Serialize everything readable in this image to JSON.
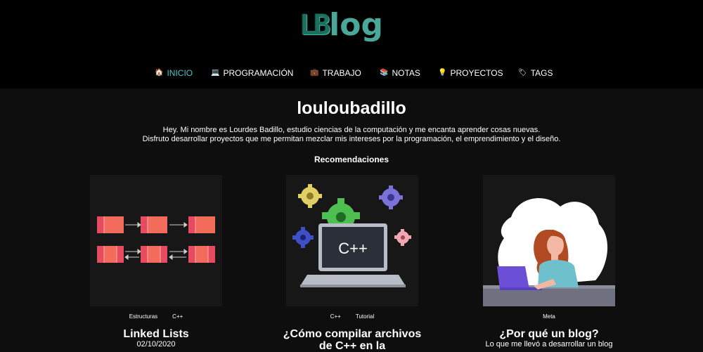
{
  "logo": {
    "brand": "LB",
    "suffix": "log"
  },
  "nav": [
    {
      "icon": "🏠",
      "label": "INICIO"
    },
    {
      "icon": "💻",
      "label": "PROGRAMACIÓN"
    },
    {
      "icon": "💼",
      "label": "TRABAJO"
    },
    {
      "icon": "📚",
      "label": "NOTAS"
    },
    {
      "icon": "💡",
      "label": "PROYECTOS"
    },
    {
      "icon": "🏷",
      "label": "TAGS"
    }
  ],
  "profile": {
    "name": "louloubadillo",
    "bio_line1": "Hey. Mi nombre es Lourdes Badillo, estudio ciencias de la computación y me encanta aprender cosas nuevas.",
    "bio_line2": "Disfruto desarrollar proyectos que me permitan mezclar mis intereses por la programación, el emprendimiento y el diseño."
  },
  "recommendations": {
    "title": "Recomendaciones",
    "cards": [
      {
        "tags": [
          "Estructuras",
          "C++"
        ],
        "title": "Linked Lists",
        "subtitle": "02/10/2020"
      },
      {
        "tags": [
          "C++",
          "Tutorial"
        ],
        "title": "¿Cómo compilar archivos de C++ en la",
        "subtitle": ""
      },
      {
        "tags": [
          "Meta"
        ],
        "title": "¿Por qué un blog?",
        "subtitle": "Lo que me llevó a desarrollar un blog"
      }
    ]
  },
  "colors": {
    "accent": "#4ec3c7",
    "topbar": "#000000",
    "background": "#0e0e0e",
    "card_bg": "#171717"
  }
}
